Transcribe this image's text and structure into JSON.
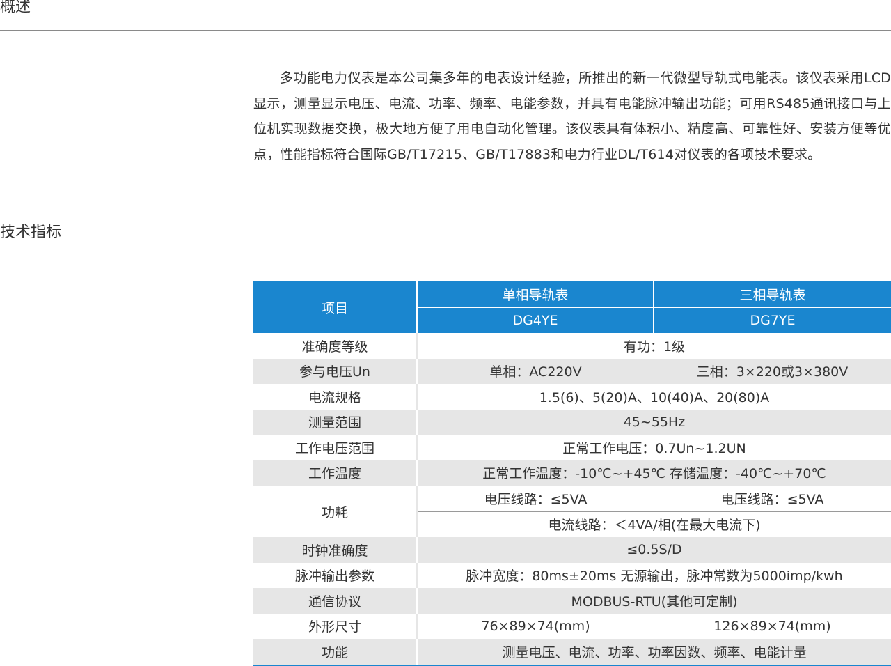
{
  "overview": {
    "title": "概述",
    "paragraph": "多功能电力仪表是本公司集多年的电表设计经验，所推出的新一代微型导轨式电能表。该仪表采用LCD显示，测量显示电压、电流、功率、频率、电能参数，并具有电能脉冲输出功能；可用RS485通讯接口与上位机实现数据交换，极大地方便了用电自动化管理。该仪表具有体积小、精度高、可靠性好、安装方便等优点，性能指标符合国际GB/T17215、GB/T17883和电力行业DL/T614对仪表的各项技术要求。"
  },
  "specs": {
    "title": "技术指标",
    "header": {
      "item": "项目",
      "single": "单相导轨表",
      "three": "三相导轨表",
      "single_model": "DG4YE",
      "three_model": "DG7YE"
    },
    "rows": {
      "accuracy": {
        "label": "准确度等级",
        "value": "有功：1级"
      },
      "voltage": {
        "label": "参与电压Un",
        "single": "单相：AC220V",
        "three": "三相：3×220或3×380V"
      },
      "current": {
        "label": "电流规格",
        "value": "1.5(6)、5(20)A、10(40)A、20(80)A"
      },
      "range": {
        "label": "测量范围",
        "value": "45~55Hz"
      },
      "work_voltage": {
        "label": "工作电压范围",
        "value": "正常工作电压：0.7Un~1.2UN"
      },
      "temperature": {
        "label": "工作温度",
        "value": "正常工作温度：-10℃~+45℃ 存储温度：-40℃~+70℃"
      },
      "power": {
        "label": "功耗",
        "single": "电压线路：≤5VA",
        "three": "电压线路：≤5VA",
        "current_line": "电流线路：＜4VA/相(在最大电流下)"
      },
      "clock": {
        "label": "时钟准确度",
        "value": "≤0.5S/D"
      },
      "pulse": {
        "label": "脉冲输出参数",
        "value": "脉冲宽度：80ms±20ms 无源输出，脉冲常数为5000imp/kwh"
      },
      "protocol": {
        "label": "通信协议",
        "value": "MODBUS-RTU(其他可定制)"
      },
      "size": {
        "label": "外形尺寸",
        "single": "76×89×74(mm)",
        "three": "126×89×74(mm)"
      },
      "function": {
        "label": "功能",
        "value": "测量电压、电流、功率、功率因数、频率、电能计量"
      }
    }
  }
}
